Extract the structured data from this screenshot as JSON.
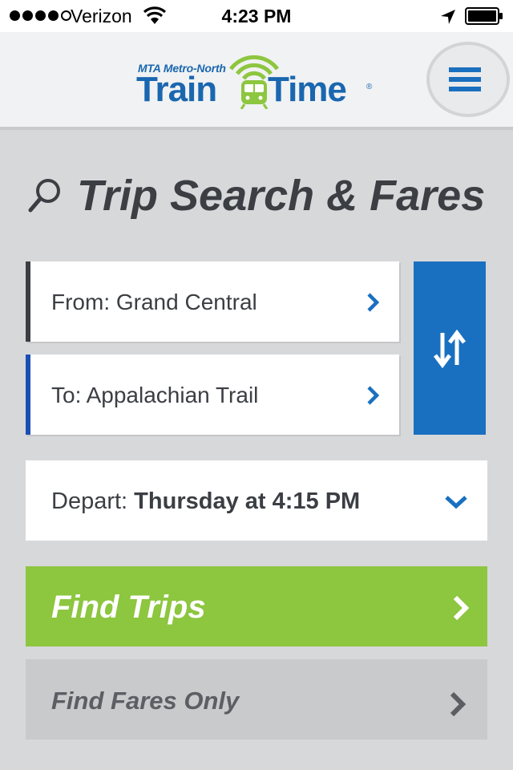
{
  "status_bar": {
    "carrier": "Verizon",
    "time": "4:23 PM",
    "signal_bars_filled": 4,
    "signal_bars_total": 5,
    "battery_level": 0.95
  },
  "header": {
    "logo_subtitle": "MTA Metro-North",
    "logo_word1": "Train",
    "logo_word2": "Time",
    "logo_trademark": "®",
    "brand_color": "#1a67b0"
  },
  "page": {
    "title": "Trip Search & Fares"
  },
  "stations": {
    "from_label": "From: Grand Central",
    "to_label": "To: Appalachian Trail"
  },
  "depart": {
    "prefix": "Depart: ",
    "value": "Thursday at 4:15 PM"
  },
  "actions": {
    "find_trips": "Find Trips",
    "find_fares": "Find Fares Only"
  },
  "colors": {
    "accent_blue": "#1a70c0",
    "find_trips_green": "#8dc63f",
    "secondary_gray": "#c9cacc",
    "text_dark": "#3b3e43"
  },
  "icons": {
    "search": "search-icon",
    "menu": "hamburger-menu-icon",
    "swap": "swap-arrows-icon",
    "chevron_right": "chevron-right-icon",
    "chevron_down": "chevron-down-icon"
  }
}
